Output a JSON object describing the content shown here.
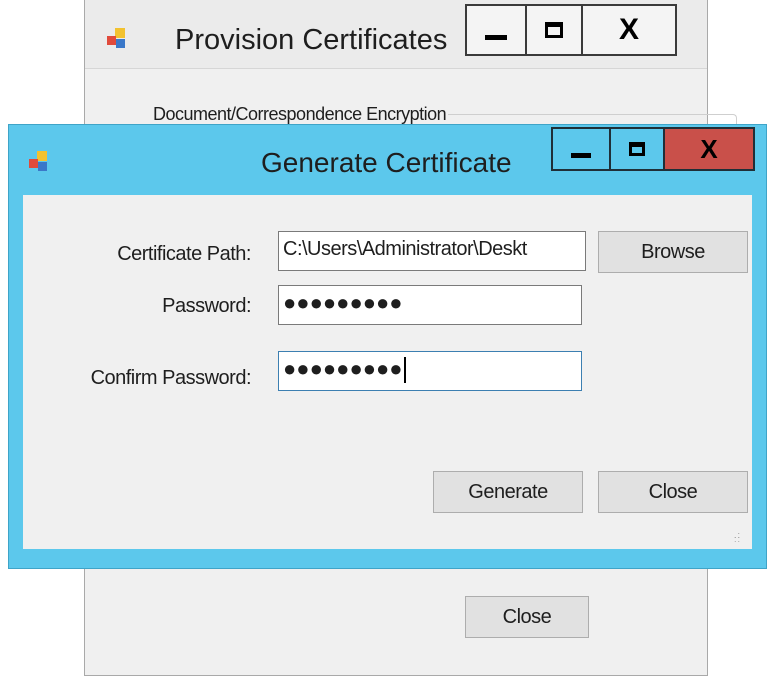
{
  "back_window": {
    "title": "Provision Certificates",
    "groupbox_label": "Document/Correspondence Encryption",
    "close_button": "Close",
    "controls": {
      "minimize": "minimize-icon",
      "maximize": "maximize-icon",
      "close": "close-icon"
    }
  },
  "front_window": {
    "title": "Generate Certificate",
    "controls": {
      "minimize": "minimize-icon",
      "maximize": "maximize-icon",
      "close": "close-icon"
    },
    "certificate_path_label": "Certificate Path:",
    "certificate_path_value": "C:\\Users\\Administrator\\Deskt",
    "browse_button": "Browse",
    "password_label": "Password:",
    "password_value": "●●●●●●●●●",
    "confirm_password_label": "Confirm Password:",
    "confirm_password_value": "●●●●●●●●●",
    "generate_button": "Generate",
    "close_button": "Close"
  },
  "colors": {
    "active_titlebar": "#5cc8ec",
    "close_button_active": "#c9504a",
    "window_background": "#f0f0f0"
  }
}
